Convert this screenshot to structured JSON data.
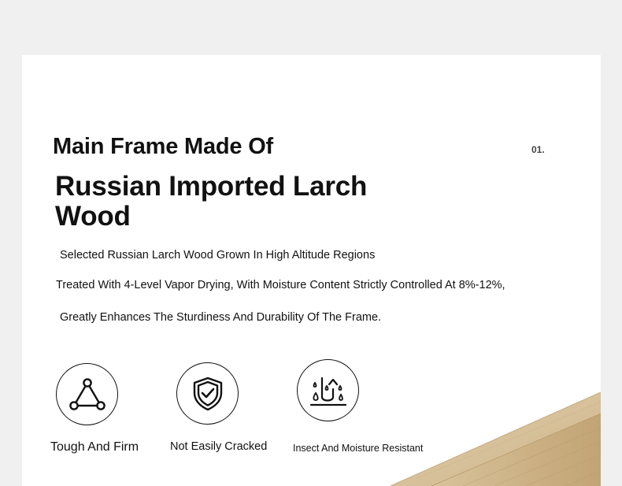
{
  "step_number": "01.",
  "title_line": "Main Frame Made Of",
  "title_main": "Russian Imported Larch Wood",
  "description": [
    "Selected Russian Larch Wood Grown In High Altitude Regions",
    "Treated With 4-Level Vapor Drying, With Moisture Content Strictly Controlled At 8%-12%,",
    "Greatly Enhances The Sturdiness And Durability Of The Frame."
  ],
  "features": [
    {
      "label": "Tough And Firm",
      "icon": "triangle-nodes-icon"
    },
    {
      "label": "Not Easily Cracked",
      "icon": "shield-check-icon"
    },
    {
      "label": "Insect And Moisture Resistant",
      "icon": "moisture-drops-icon"
    }
  ],
  "colors": {
    "page_background": "#f0f0f0",
    "card_background": "#ffffff",
    "text": "#111111",
    "wood_light": "#d9c4a0",
    "wood_dark": "#b89b6d"
  }
}
